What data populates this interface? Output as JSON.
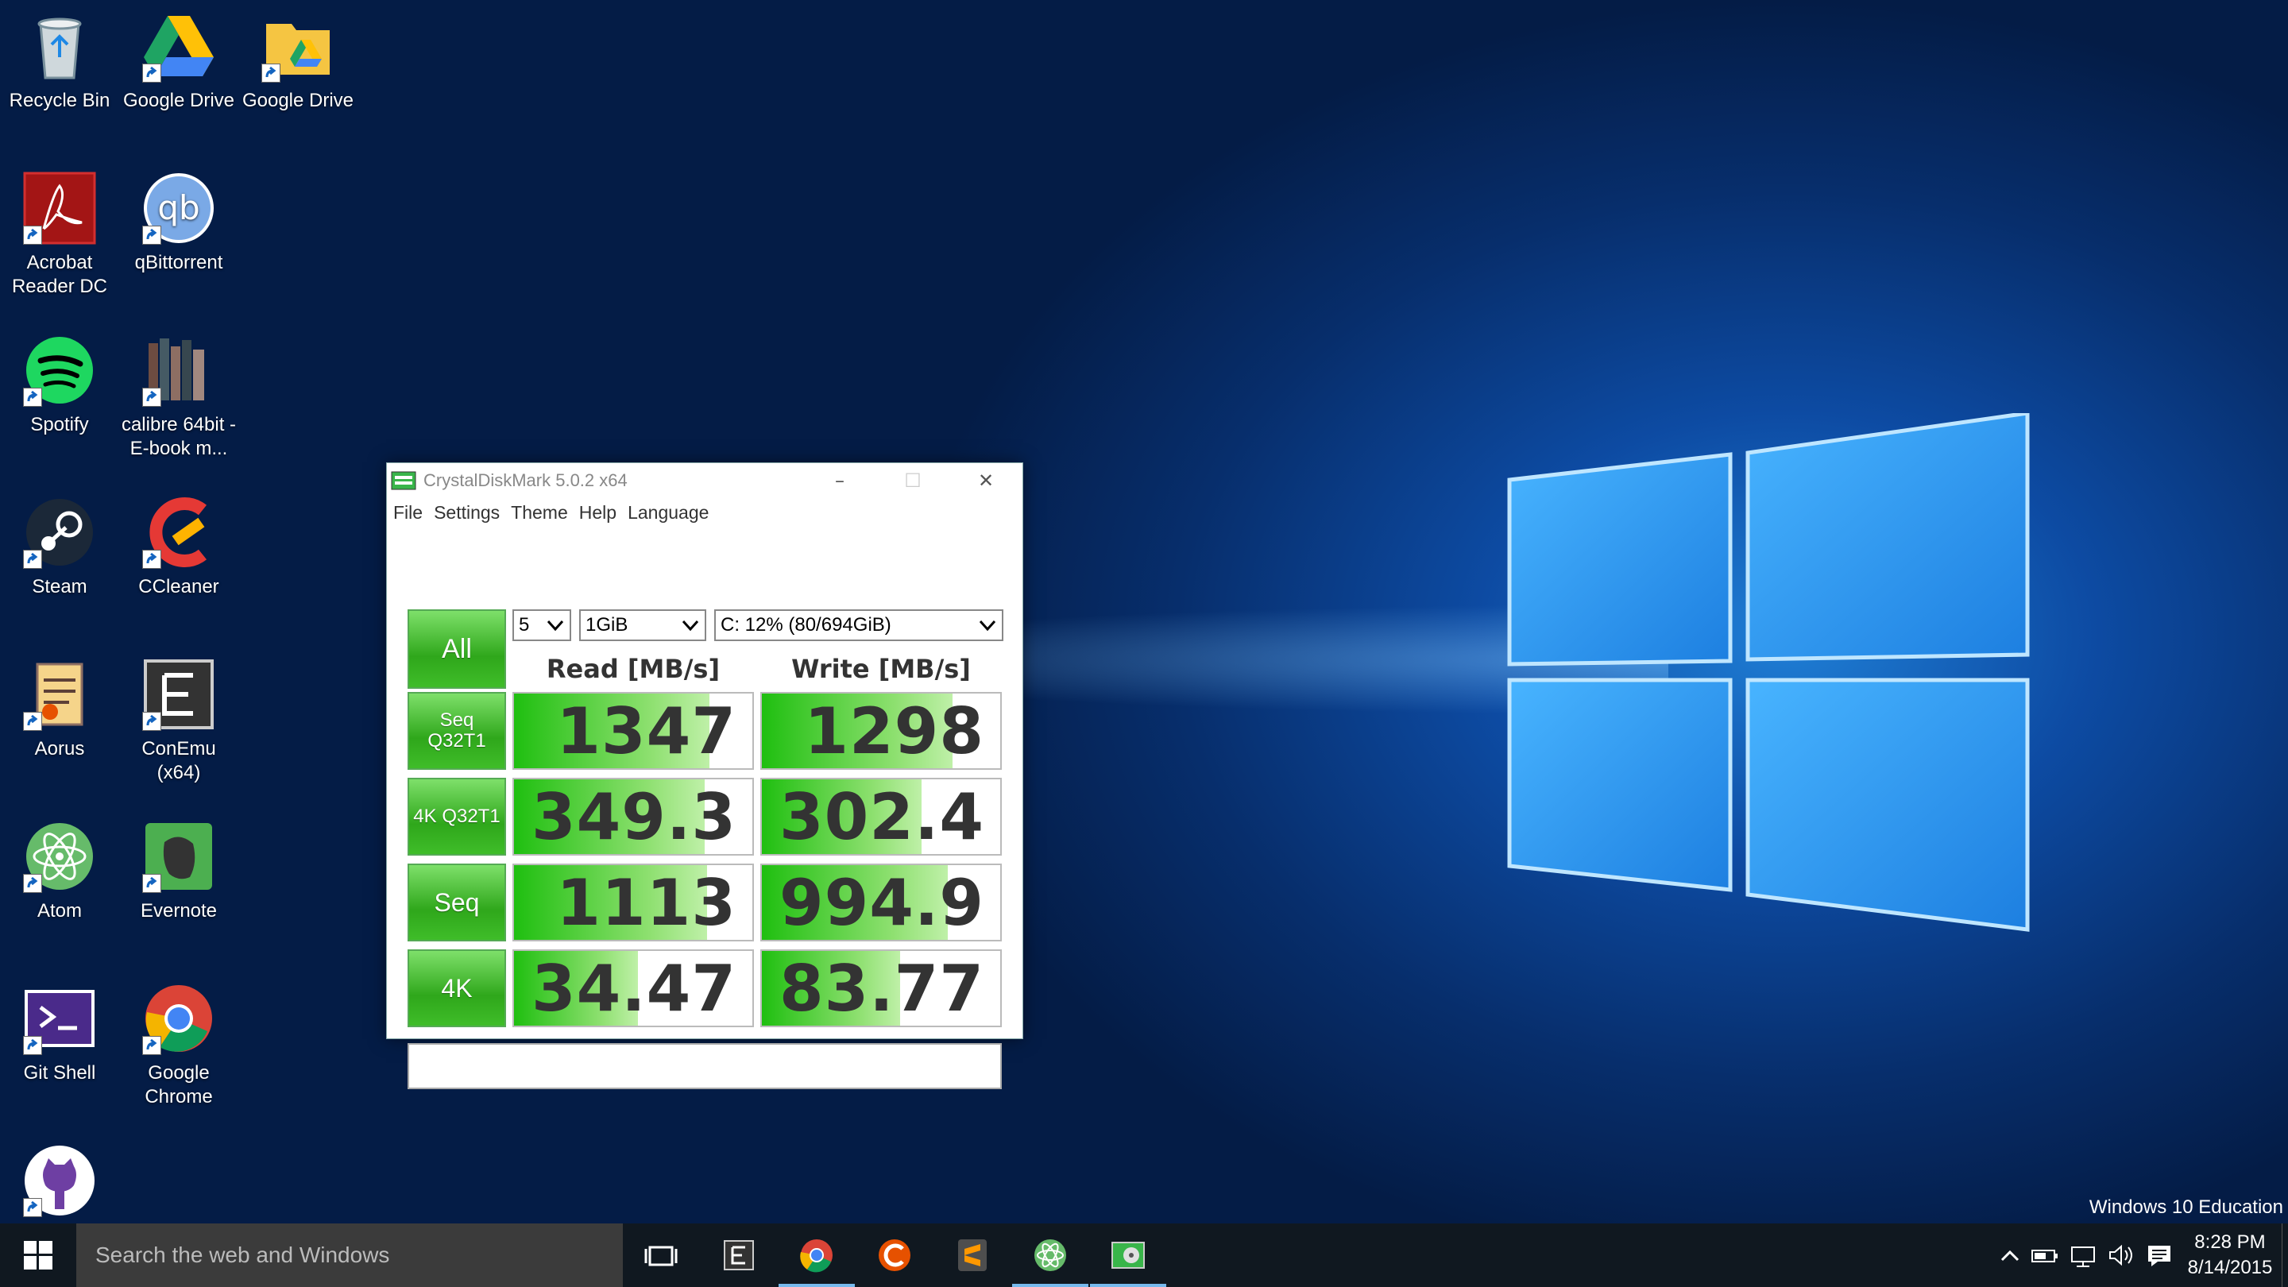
{
  "desktop": {
    "icons": [
      {
        "label": "Recycle Bin",
        "icon": "recycle-bin-icon"
      },
      {
        "label": "Google Drive",
        "icon": "google-drive-icon"
      },
      {
        "label": "Google Drive",
        "icon": "google-drive-folder-icon"
      },
      {
        "label": "Acrobat Reader DC",
        "icon": "acrobat-icon"
      },
      {
        "label": "qBittorrent",
        "icon": "qbittorrent-icon"
      },
      {
        "label": "Spotify",
        "icon": "spotify-icon"
      },
      {
        "label": "calibre 64bit - E-book m...",
        "icon": "calibre-icon"
      },
      {
        "label": "Steam",
        "icon": "steam-icon"
      },
      {
        "label": "CCleaner",
        "icon": "ccleaner-icon"
      },
      {
        "label": "Aorus",
        "icon": "aorus-icon"
      },
      {
        "label": "ConEmu (x64)",
        "icon": "conemu-icon"
      },
      {
        "label": "Atom",
        "icon": "atom-icon"
      },
      {
        "label": "Evernote",
        "icon": "evernote-icon"
      },
      {
        "label": "Git Shell",
        "icon": "git-shell-icon"
      },
      {
        "label": "Google Chrome",
        "icon": "chrome-icon"
      },
      {
        "label": "GitHub",
        "icon": "github-icon"
      }
    ]
  },
  "cdm": {
    "title": "CrystalDiskMark 5.0.2 x64",
    "menu": [
      "File",
      "Settings",
      "Theme",
      "Help",
      "Language"
    ],
    "all_label": "All",
    "count": "5",
    "size": "1GiB",
    "drive": "C: 12% (80/694GiB)",
    "read_header": "Read [MB/s]",
    "write_header": "Write [MB/s]",
    "rows": [
      {
        "label": "Seq Q32T1",
        "read": "1347",
        "write": "1298",
        "read_fill": 0.82,
        "write_fill": 0.8
      },
      {
        "label": "4K Q32T1",
        "read": "349.3",
        "write": "302.4",
        "read_fill": 0.8,
        "write_fill": 0.67
      },
      {
        "label": "Seq",
        "read": "1113",
        "write": "994.9",
        "read_fill": 0.81,
        "write_fill": 0.78
      },
      {
        "label": "4K",
        "read": "34.47",
        "write": "83.77",
        "read_fill": 0.52,
        "write_fill": 0.58
      }
    ]
  },
  "taskbar": {
    "search_placeholder": "Search the web and Windows",
    "time": "8:28 PM",
    "date": "8/14/2015",
    "edition": "Windows 10 Education",
    "apps": [
      "task-view-icon",
      "conemu-icon",
      "chrome-icon",
      "ccleaner-icon",
      "sublime-icon",
      "atom-icon",
      "crystaldiskmark-icon"
    ]
  }
}
